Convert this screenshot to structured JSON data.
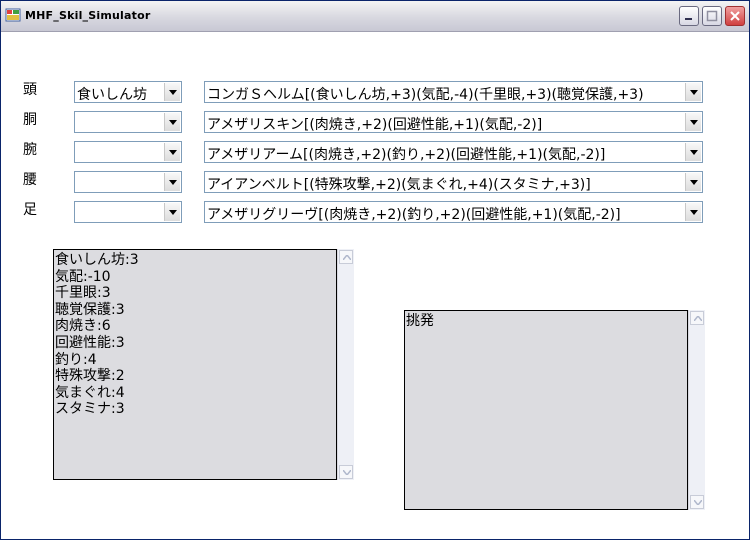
{
  "window": {
    "title": "MHF_Skil_Simulator"
  },
  "titlebar_buttons": {
    "minimize": "minimize",
    "maximize": "maximize",
    "close": "close"
  },
  "rows": [
    {
      "label": "頭",
      "skill_select": "食いしん坊",
      "equip_select": "コンガＳヘルム[(食いしん坊,+3)(気配,-4)(千里眼,+3)(聴覚保護,+3)"
    },
    {
      "label": "胴",
      "skill_select": "",
      "equip_select": "アメザリスキン[(肉焼き,+2)(回避性能,+1)(気配,-2)]"
    },
    {
      "label": "腕",
      "skill_select": "",
      "equip_select": "アメザリアーム[(肉焼き,+2)(釣り,+2)(回避性能,+1)(気配,-2)]"
    },
    {
      "label": "腰",
      "skill_select": "",
      "equip_select": "アイアンベルト[(特殊攻撃,+2)(気まぐれ,+4)(スタミナ,+3)]"
    },
    {
      "label": "足",
      "skill_select": "",
      "equip_select": "アメザリグリーヴ[(肉焼き,+2)(釣り,+2)(回避性能,+1)(気配,-2)]"
    }
  ],
  "skill_totals": [
    "食いしん坊:3",
    "気配:-10",
    "千里眼:3",
    "聴覚保護:3",
    "肉焼き:6",
    "回避性能:3",
    "釣り:4",
    "特殊攻撃:2",
    "気まぐれ:4",
    "スタミナ:3"
  ],
  "activated_skills": [
    "挑発"
  ]
}
